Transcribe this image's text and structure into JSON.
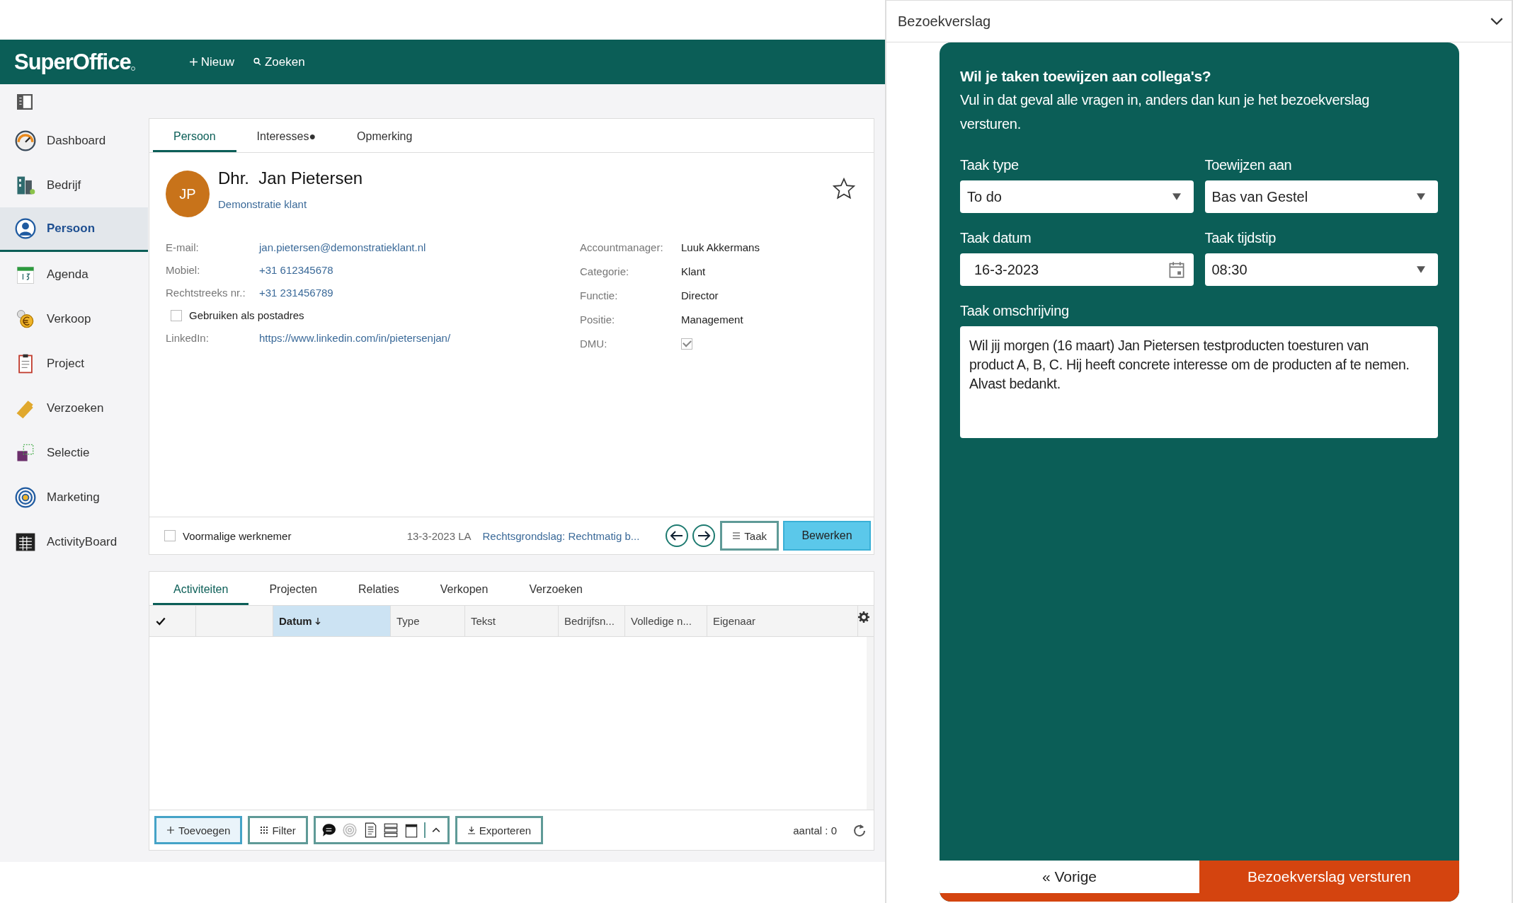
{
  "app": {
    "logo": "SuperOffice",
    "header_actions": [
      {
        "kind": "plus",
        "label": "Nieuw"
      },
      {
        "kind": "search",
        "label": "Zoeken"
      }
    ]
  },
  "sidebar": {
    "items": [
      {
        "kind": "dashboard",
        "label": "Dashboard",
        "selected": false
      },
      {
        "kind": "company",
        "label": "Bedrijf",
        "selected": false
      },
      {
        "kind": "person",
        "label": "Persoon",
        "selected": true
      },
      {
        "kind": "calendar",
        "label": "Agenda",
        "selected": false
      },
      {
        "kind": "sale",
        "label": "Verkoop",
        "selected": false
      },
      {
        "kind": "project",
        "label": "Project",
        "selected": false
      },
      {
        "kind": "ticket",
        "label": "Verzoeken",
        "selected": false
      },
      {
        "kind": "selection",
        "label": "Selectie",
        "selected": false
      },
      {
        "kind": "target",
        "label": "Marketing",
        "selected": false
      },
      {
        "kind": "board",
        "label": "ActivityBoard",
        "selected": false
      }
    ]
  },
  "person_card": {
    "tabs": [
      {
        "label": "Persoon",
        "selected": true
      },
      {
        "label": "Interesses",
        "selected": false,
        "badge": "●"
      },
      {
        "label": "Opmerking",
        "selected": false
      }
    ],
    "initials": "JP",
    "salutation": "Dhr.",
    "name": "Jan Pietersen",
    "company": "Demonstratie klant",
    "favorite": false,
    "fields_left": [
      {
        "kind": "link",
        "label": "E-mail:",
        "value": "jan.pietersen@demonstratieklant.nl"
      },
      {
        "kind": "link",
        "label": "Mobiel:",
        "value": "+31 612345678"
      },
      {
        "kind": "link",
        "label": "Rechtstreeks nr.:",
        "value": "+31 231456789"
      },
      {
        "kind": "checkbox",
        "label": "Gebruiken als postadres",
        "checked": false
      },
      {
        "kind": "link",
        "label": "LinkedIn:",
        "value": "https://www.linkedin.com/in/pietersenjan/"
      }
    ],
    "fields_right": [
      {
        "kind": "text",
        "label": "Accountmanager:",
        "value": "Luuk Akkermans"
      },
      {
        "kind": "text",
        "label": "Categorie:",
        "value": "Klant"
      },
      {
        "kind": "text",
        "label": "Functie:",
        "value": "Director"
      },
      {
        "kind": "text",
        "label": "Positie:",
        "value": "Management"
      },
      {
        "kind": "checkbox",
        "label": "DMU:",
        "checked": true
      }
    ],
    "footer": {
      "former_employee": {
        "label": "Voormalige werknemer",
        "checked": false
      },
      "updated": "13-3-2023 LA",
      "legal_basis": "Rechtsgrondslag: Rechtmatig b...",
      "task_button": "Taak",
      "edit_button": "Bewerken"
    }
  },
  "activities": {
    "tabs": [
      {
        "label": "Activiteiten",
        "selected": true
      },
      {
        "label": "Projecten",
        "selected": false
      },
      {
        "label": "Relaties",
        "selected": false
      },
      {
        "label": "Verkopen",
        "selected": false
      },
      {
        "label": "Verzoeken",
        "selected": false
      }
    ],
    "columns": [
      {
        "label": "Datum",
        "sorted": true
      },
      {
        "label": "Type",
        "sorted": false
      },
      {
        "label": "Tekst",
        "sorted": false
      },
      {
        "label": "Bedrijfsn...",
        "sorted": false
      },
      {
        "label": "Volledige n...",
        "sorted": false
      },
      {
        "label": "Eigenaar",
        "sorted": false
      }
    ],
    "add_button": "Toevoegen",
    "filter_button": "Filter",
    "export_button": "Exporteren",
    "count": "aantal : 0"
  },
  "visit_report": {
    "title": "Bezoekverslag",
    "heading": "Wil je taken toewijzen aan collega's?",
    "intro": "Vul in dat geval alle vragen in, anders dan kun je het bezoekverslag versturen.",
    "fields": [
      {
        "kind": "select",
        "label": "Taak type",
        "value": "To do"
      },
      {
        "kind": "select",
        "label": "Toewijzen aan",
        "value": "Bas van Gestel"
      },
      {
        "kind": "date",
        "label": "Taak datum",
        "value": "16-3-2023"
      },
      {
        "kind": "select",
        "label": "Taak tijdstip",
        "value": "08:30"
      }
    ],
    "description_label": "Taak omschrijving",
    "description": "Wil jij morgen (16 maart) Jan Pietersen testproducten toesturen van product A, B, C. Hij heeft concrete interesse om de producten af te nemen. Alvast bedankt.",
    "back_button": "« Vorige",
    "submit_button": "Bezoekverslag versturen"
  }
}
